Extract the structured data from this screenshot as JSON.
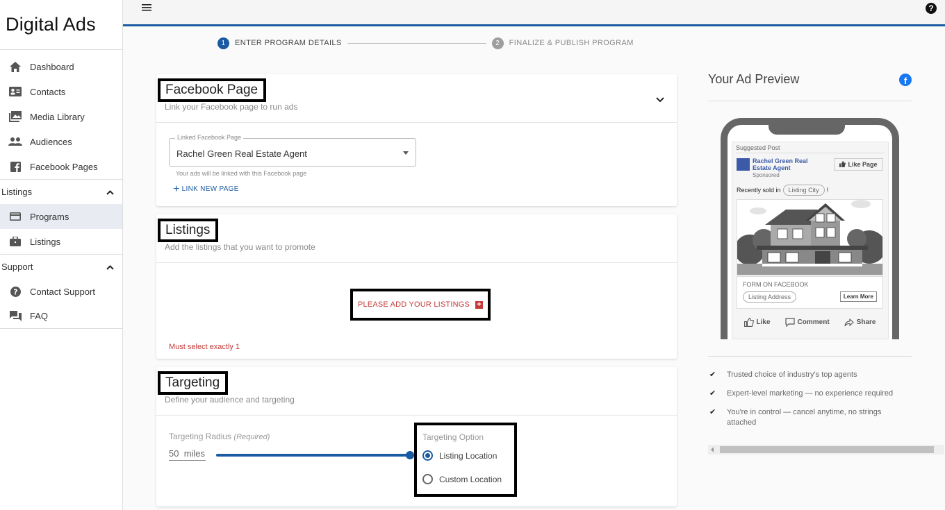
{
  "app": {
    "brand": "Digital Ads"
  },
  "sidebar": {
    "items": [
      {
        "label": "Dashboard",
        "icon": "home-icon"
      },
      {
        "label": "Contacts",
        "icon": "contact-card-icon"
      },
      {
        "label": "Media Library",
        "icon": "photo-library-icon"
      },
      {
        "label": "Audiences",
        "icon": "people-icon"
      },
      {
        "label": "Facebook Pages",
        "icon": "facebook-icon"
      }
    ],
    "listings_section": {
      "label": "Listings",
      "items": [
        {
          "label": "Programs"
        },
        {
          "label": "Listings"
        }
      ]
    },
    "support_section": {
      "label": "Support",
      "items": [
        {
          "label": "Contact Support"
        },
        {
          "label": "FAQ"
        }
      ]
    }
  },
  "stepper": {
    "steps": [
      {
        "num": "1",
        "label": "ENTER PROGRAM DETAILS"
      },
      {
        "num": "2",
        "label": "FINALIZE & PUBLISH PROGRAM"
      }
    ]
  },
  "facebook_card": {
    "title": "Facebook Page",
    "subtitle": "Link your Facebook page to run ads",
    "select_legend": "Linked Facebook Page",
    "select_value": "Rachel Green Real Estate Agent",
    "helper": "Your ads will be linked with this Facebook page",
    "link_new": "LINK NEW PAGE"
  },
  "listings_card": {
    "title": "Listings",
    "subtitle": "Add the listings that you want to promote",
    "add_button": "PLEASE ADD YOUR LISTINGS",
    "error": "Must select exactly 1"
  },
  "targeting_card": {
    "title": "Targeting",
    "subtitle": "Define your audience and targeting",
    "radius_label": "Targeting Radius",
    "radius_required": "(Required)",
    "radius_value": "50",
    "radius_unit": "miles",
    "radius_fill_fraction": 1.0,
    "option_title": "Targeting Option",
    "options": [
      {
        "label": "Listing Location",
        "selected": true
      },
      {
        "label": "Custom Location",
        "selected": false
      }
    ]
  },
  "preview": {
    "title": "Your Ad Preview",
    "suggested": "Suggested Post",
    "page_name": "Rachel Green Real Estate Agent",
    "sponsored": "Sponsored",
    "like_page": "Like Page",
    "recent_prefix": "Recently sold in",
    "city_pill": "Listing City",
    "recent_suffix": "!",
    "form_label": "FORM ON FACEBOOK",
    "address_pill": "Listing Address",
    "learn_more": "Learn More",
    "actions": {
      "like": "Like",
      "comment": "Comment",
      "share": "Share"
    }
  },
  "features": [
    "Trusted choice of industry's top agents",
    "Expert-level marketing — no experience required",
    "You're in control — cancel anytime, no strings attached"
  ],
  "colors": {
    "primary": "#1a5aa0",
    "error": "#c43a3a",
    "facebook": "#1877f2"
  }
}
